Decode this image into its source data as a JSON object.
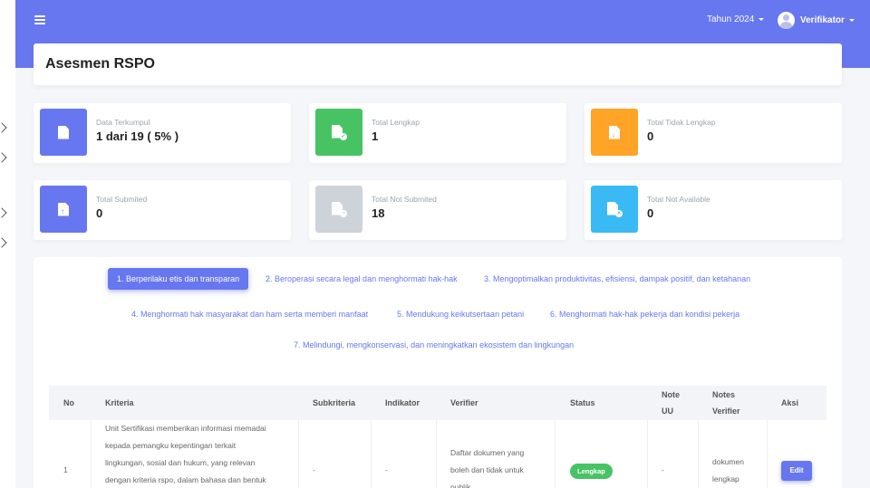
{
  "header": {
    "year_label": "Tahun 2024",
    "user_name": "Verifikator"
  },
  "page_title": "Asesmen RSPO",
  "cards": [
    {
      "label": "Data Terkumpul",
      "value": "1 dari 19 ( 5% )",
      "color": "#6777ef",
      "icon": "file-icon"
    },
    {
      "label": "Total Lengkap",
      "value": "1",
      "color": "#47c363",
      "icon": "file-check-icon"
    },
    {
      "label": "Total Tidak Lengkap",
      "value": "0",
      "color": "#ffa426",
      "icon": "file-download-icon"
    },
    {
      "label": "Total Submited",
      "value": "0",
      "color": "#6777ef",
      "icon": "file-upload-icon"
    },
    {
      "label": "Total Not Submited",
      "value": "18",
      "color": "#cdd3d8",
      "icon": "file-clock-icon"
    },
    {
      "label": "Total Not Available",
      "value": "0",
      "color": "#3abaf4",
      "icon": "file-x-icon"
    }
  ],
  "tabs": [
    {
      "label": "1. Berperilaku etis dan transparan",
      "active": true
    },
    {
      "label": "2. Beroperasi secara legal dan menghormati hak-hak"
    },
    {
      "label": "3. Mengoptimalkan produktivitas, efisiensi, dampak positif, dan ketahanan"
    },
    {
      "label": "4. Menghormati hak masyarakat dan ham serta memberi manfaat"
    },
    {
      "label": "5. Mendukung keikutsertaan petani"
    },
    {
      "label": "6. Menghormati hak-hak pekerja dan kondisi pekerja"
    },
    {
      "label": "7. Melindungi, mengkonservasi, dan meningkatkan ekosistem dan lingkungan"
    }
  ],
  "table": {
    "headers": {
      "no": "No",
      "kriteria": "Kriteria",
      "subkriteria": "Subkriteria",
      "indikator": "Indikator",
      "verifier": "Verifier",
      "status": "Status",
      "note_uu_1": "Note",
      "note_uu_2": "UU",
      "notes_verifier_1": "Notes",
      "notes_verifier_2": "Verifier",
      "aksi": "Aksi"
    },
    "rows": [
      {
        "no": "1",
        "kriteria_lines": [
          "Unit Sertifikasi memberikan informasi memadai",
          "kepada pemangku kepentingan terkait",
          "lingkungan, sosial dan hukum, yang relevan",
          "dengan kriteria rspo, dalam bahasa dan bentuk"
        ],
        "subkriteria": "-",
        "indikator": "-",
        "verifier_lines": [
          "Daftar dokumen yang",
          "boleh dan tidak untuk",
          "publik"
        ],
        "status": "Lengkap",
        "note_uu": "-",
        "notes_verifier_lines": [
          "dokumen",
          "lengkap"
        ],
        "action": "Edit"
      }
    ]
  },
  "colors": {
    "primary": "#6777ef",
    "success": "#47c363",
    "warning": "#ffa426",
    "info": "#3abaf4",
    "muted": "#cdd3d8"
  }
}
